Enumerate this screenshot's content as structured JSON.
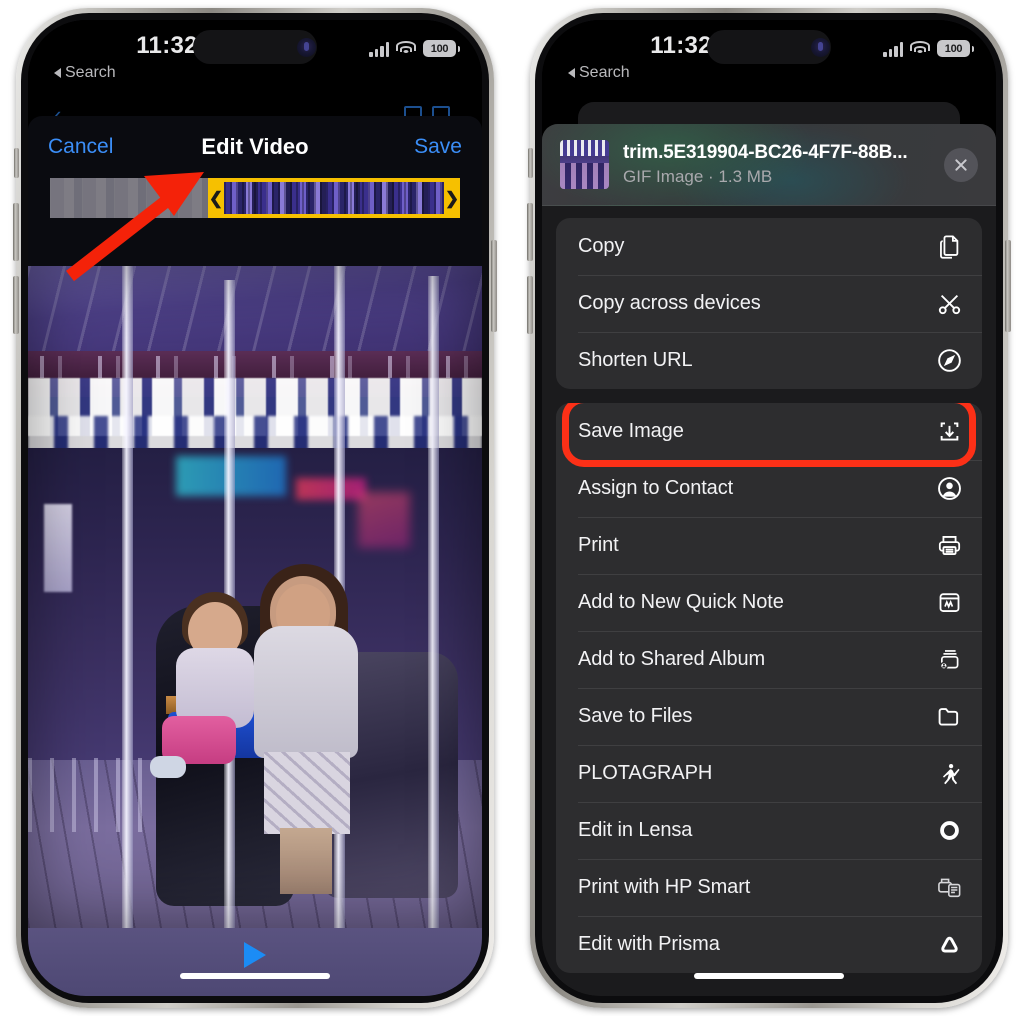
{
  "status_bar": {
    "time": "11:32",
    "back_label": "Search",
    "battery": "100",
    "signal_icon": "cellular-signal-icon",
    "wifi_icon": "wifi-icon",
    "battery_icon": "battery-icon"
  },
  "left_phone": {
    "editor": {
      "cancel_label": "Cancel",
      "title": "Edit Video",
      "save_label": "Save",
      "trim_handle_left": "❮",
      "trim_handle_right": "❯",
      "play_icon": "play-icon",
      "trim_selection_color": "#F6C000"
    },
    "annotation": {
      "arrow_icon": "red-arrow-annotation",
      "color": "#F42209"
    }
  },
  "right_phone": {
    "share_sheet": {
      "file_name": "trim.5E319904-BC26-4F7F-88B...",
      "file_meta": "GIF Image · 1.3 MB",
      "close_icon": "close-icon",
      "thumbnail_icon": "file-thumbnail",
      "groups": [
        {
          "items": [
            {
              "label": "Copy",
              "icon": "copy-icon"
            },
            {
              "label": "Copy across devices",
              "icon": "scissors-icon"
            },
            {
              "label": "Shorten URL",
              "icon": "compass-icon"
            }
          ]
        },
        {
          "items": [
            {
              "label": "Save Image",
              "icon": "save-image-icon",
              "highlighted": true
            },
            {
              "label": "Assign to Contact",
              "icon": "person-circle-icon"
            },
            {
              "label": "Print",
              "icon": "printer-icon"
            },
            {
              "label": "Add to New Quick Note",
              "icon": "quick-note-icon"
            },
            {
              "label": "Add to Shared Album",
              "icon": "shared-album-icon"
            },
            {
              "label": "Save to Files",
              "icon": "folder-icon"
            },
            {
              "label": "PLOTAGRAPH",
              "icon": "plotagraph-icon"
            },
            {
              "label": "Edit in Lensa",
              "icon": "lensa-circle-icon"
            },
            {
              "label": "Print with HP Smart",
              "icon": "hp-printer-icon"
            },
            {
              "label": "Edit with Prisma",
              "icon": "prisma-triangle-icon"
            }
          ]
        }
      ],
      "highlight_color": "#FC3017"
    }
  }
}
